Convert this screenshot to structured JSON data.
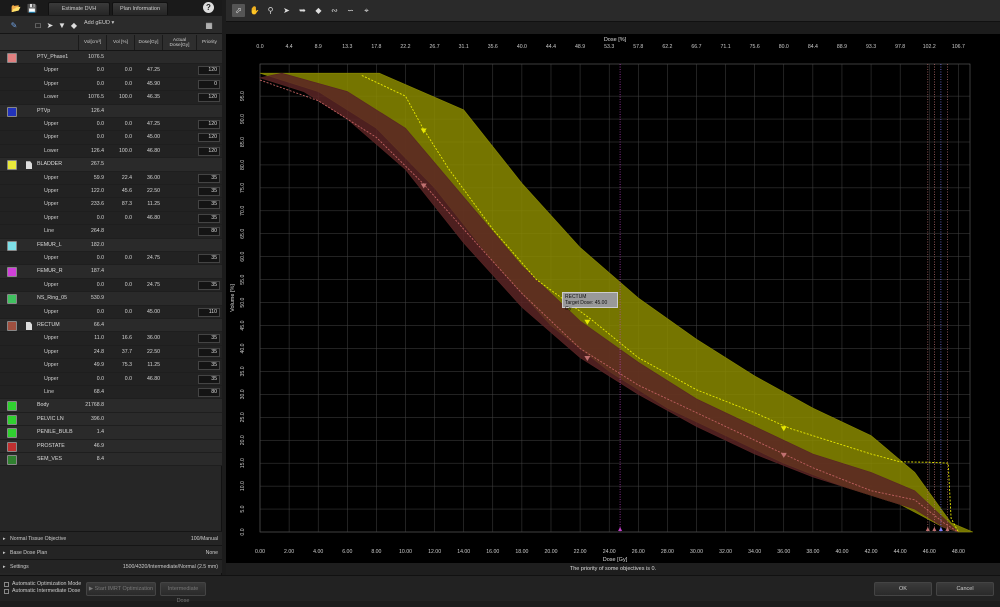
{
  "left_tabs": [
    {
      "label": "Estimate DVH"
    },
    {
      "label": "Plan Information"
    }
  ],
  "toolbar": {
    "add_label": "Add gEUD"
  },
  "columns": [
    {
      "label": "Vol[cm³]"
    },
    {
      "label": "Vol [%]"
    },
    {
      "label": "Dose[Gy]"
    },
    {
      "label": "Actual Dose[Gy]"
    },
    {
      "label": "Priority"
    }
  ],
  "rows": [
    {
      "kind": "s",
      "name": "PTV_Phase1",
      "vol": "1076.5",
      "color": "#e08080"
    },
    {
      "kind": "c",
      "label": "Upper",
      "v1": "0.0",
      "v2": "0.0",
      "dose": "47.25",
      "pri": "120"
    },
    {
      "kind": "c",
      "label": "Upper",
      "v1": "0.0",
      "v2": "0.0",
      "dose": "45.90",
      "pri": "0"
    },
    {
      "kind": "c",
      "label": "Lower",
      "v1": "1076.5",
      "v2": "100.0",
      "dose": "46.35",
      "pri": "120"
    },
    {
      "kind": "s",
      "name": "PTVp",
      "vol": "126.4",
      "color": "#2233bb"
    },
    {
      "kind": "c",
      "label": "Upper",
      "v1": "0.0",
      "v2": "0.0",
      "dose": "47.25",
      "pri": "120"
    },
    {
      "kind": "c",
      "label": "Upper",
      "v1": "0.0",
      "v2": "0.0",
      "dose": "45.00",
      "pri": "120"
    },
    {
      "kind": "c",
      "label": "Lower",
      "v1": "126.4",
      "v2": "100.0",
      "dose": "46.80",
      "pri": "120"
    },
    {
      "kind": "s",
      "name": "BLADDER",
      "vol": "267.5",
      "color": "#e8e83a",
      "doc": true
    },
    {
      "kind": "c",
      "label": "Upper",
      "v1": "59.9",
      "v2": "22.4",
      "dose": "36.00",
      "pri": "35"
    },
    {
      "kind": "c",
      "label": "Upper",
      "v1": "122.0",
      "v2": "45.6",
      "dose": "22.50",
      "pri": "35"
    },
    {
      "kind": "c",
      "label": "Upper",
      "v1": "233.6",
      "v2": "87.3",
      "dose": "11.25",
      "pri": "35"
    },
    {
      "kind": "c",
      "label": "Upper",
      "v1": "0.0",
      "v2": "0.0",
      "dose": "46.80",
      "pri": "35"
    },
    {
      "kind": "c",
      "label": "Line",
      "v1": "264.8",
      "v2": "",
      "dose": "",
      "pri": "80"
    },
    {
      "kind": "s",
      "name": "FEMUR_L",
      "vol": "182.0",
      "color": "#7ee0e8"
    },
    {
      "kind": "c",
      "label": "Upper",
      "v1": "0.0",
      "v2": "0.0",
      "dose": "24.75",
      "pri": "35"
    },
    {
      "kind": "s",
      "name": "FEMUR_R",
      "vol": "187.4",
      "color": "#d040d8"
    },
    {
      "kind": "c",
      "label": "Upper",
      "v1": "0.0",
      "v2": "0.0",
      "dose": "24.75",
      "pri": "35"
    },
    {
      "kind": "s",
      "name": "NS_Ring_05",
      "vol": "530.9",
      "color": "#40c060"
    },
    {
      "kind": "c",
      "label": "Upper",
      "v1": "0.0",
      "v2": "0.0",
      "dose": "45.00",
      "pri": "110"
    },
    {
      "kind": "s",
      "name": "RECTUM",
      "vol": "66.4",
      "color": "#a05040",
      "doc": true
    },
    {
      "kind": "c",
      "label": "Upper",
      "v1": "11.0",
      "v2": "16.6",
      "dose": "36.00",
      "pri": "35"
    },
    {
      "kind": "c",
      "label": "Upper",
      "v1": "24.8",
      "v2": "37.7",
      "dose": "22.50",
      "pri": "35"
    },
    {
      "kind": "c",
      "label": "Upper",
      "v1": "49.9",
      "v2": "75.3",
      "dose": "11.25",
      "pri": "35"
    },
    {
      "kind": "c",
      "label": "Upper",
      "v1": "0.0",
      "v2": "0.0",
      "dose": "46.80",
      "pri": "35"
    },
    {
      "kind": "c",
      "label": "Line",
      "v1": "68.4",
      "v2": "",
      "dose": "",
      "pri": "80"
    },
    {
      "kind": "s",
      "name": "Body",
      "vol": "21768.8",
      "color": "#30d030"
    },
    {
      "kind": "s",
      "name": "PELVIC LN",
      "vol": "396.0",
      "color": "#30d030"
    },
    {
      "kind": "s",
      "name": "PENILE_BULB",
      "vol": "1.4",
      "color": "#30d030"
    },
    {
      "kind": "s",
      "name": "PROSTATE",
      "vol": "46.9",
      "color": "#c03030"
    },
    {
      "kind": "s",
      "name": "SEM_VES",
      "vol": "8.4",
      "color": "#308030"
    }
  ],
  "sections": [
    {
      "label": "Normal Tissue Objective",
      "value": "100/Manual"
    },
    {
      "label": "Base Dose Plan",
      "value": "None"
    },
    {
      "label": "Settings",
      "value": "1500/4320/Intermediate/Normal (2.5 mm)"
    }
  ],
  "footer": {
    "mode1": "Automatic Optimization Mode",
    "mode2": "Automatic Intermediate Dose",
    "start": "Start IMRT Optimization",
    "intermediate": "Intermediate Dose",
    "ok": "OK",
    "cancel": "Cancel"
  },
  "status": "The priority of some objectives is 0.",
  "tooltip": {
    "line1": "RECTUM",
    "line2": "Target Dose: 45.00 Gy"
  },
  "chart_data": {
    "type": "line",
    "title": "",
    "xlabel": "Dose [Gy]",
    "top_xlabel": "Dose [%]",
    "ylabel": "Volume [%]",
    "xlim": [
      0,
      48
    ],
    "ylim": [
      0,
      100
    ],
    "x_ticks": [
      "0.00",
      "2.00",
      "4.00",
      "6.00",
      "8.00",
      "10.00",
      "12.00",
      "14.00",
      "16.00",
      "18.00",
      "20.00",
      "22.00",
      "24.00",
      "26.00",
      "28.00",
      "30.00",
      "32.00",
      "34.00",
      "36.00",
      "38.00",
      "40.00",
      "42.00",
      "44.00",
      "46.00",
      "48.00"
    ],
    "top_ticks": [
      "0.0",
      "4.4",
      "8.9",
      "13.3",
      "17.8",
      "22.2",
      "26.7",
      "31.1",
      "35.6",
      "40.0",
      "44.4",
      "48.9",
      "53.3",
      "57.8",
      "62.2",
      "66.7",
      "71.1",
      "75.6",
      "80.0",
      "84.4",
      "88.9",
      "93.3",
      "97.8",
      "102.2",
      "106.7"
    ],
    "y_ticks": [
      "0.0",
      "5.0",
      "10.0",
      "15.0",
      "20.0",
      "25.0",
      "30.0",
      "35.0",
      "40.0",
      "45.0",
      "50.0",
      "55.0",
      "60.0",
      "65.0",
      "70.0",
      "75.0",
      "80.0",
      "85.0",
      "90.0",
      "95.0"
    ],
    "bladder_band": {
      "color": "#8a8a00",
      "upper": [
        [
          6.2,
          100
        ],
        [
          8.2,
          100
        ],
        [
          14,
          92
        ],
        [
          18,
          76
        ],
        [
          22,
          62
        ],
        [
          26,
          51
        ],
        [
          30,
          42
        ],
        [
          34,
          34
        ],
        [
          38,
          27
        ],
        [
          42,
          21
        ],
        [
          45,
          13
        ],
        [
          47.5,
          2
        ],
        [
          49,
          0
        ]
      ],
      "lower": [
        [
          0,
          100
        ],
        [
          4,
          96
        ],
        [
          8,
          88
        ],
        [
          12,
          75
        ],
        [
          16,
          59
        ],
        [
          20,
          45
        ],
        [
          24,
          35
        ],
        [
          28,
          27
        ],
        [
          32,
          21
        ],
        [
          36,
          15
        ],
        [
          40,
          10
        ],
        [
          44,
          6
        ],
        [
          47,
          1
        ],
        [
          48,
          0
        ]
      ]
    },
    "rectum_band": {
      "color": "#5a2424",
      "upper": [
        [
          1.5,
          100
        ],
        [
          6,
          96
        ],
        [
          10,
          88
        ],
        [
          14,
          73
        ],
        [
          18,
          58
        ],
        [
          22,
          46
        ],
        [
          26,
          37
        ],
        [
          30,
          29
        ],
        [
          34,
          23
        ],
        [
          38,
          17
        ],
        [
          42,
          13
        ],
        [
          45,
          9
        ],
        [
          47,
          3
        ],
        [
          48,
          0
        ]
      ],
      "lower": [
        [
          0,
          99
        ],
        [
          3,
          96
        ],
        [
          6,
          90
        ],
        [
          10,
          79
        ],
        [
          14,
          63
        ],
        [
          18,
          49
        ],
        [
          22,
          38
        ],
        [
          26,
          30
        ],
        [
          30,
          23
        ],
        [
          34,
          17
        ],
        [
          38,
          12
        ],
        [
          42,
          8
        ],
        [
          45,
          5
        ],
        [
          47,
          1
        ],
        [
          48,
          0
        ]
      ]
    },
    "bladder_line": {
      "color": "#e8e800",
      "points": [
        [
          7,
          99.5
        ],
        [
          10,
          95
        ],
        [
          11.2,
          88
        ],
        [
          13,
          79
        ],
        [
          16,
          66
        ],
        [
          19,
          55
        ],
        [
          22.7,
          46.5
        ],
        [
          26,
          38
        ],
        [
          30,
          31
        ],
        [
          34,
          26
        ],
        [
          36.4,
          22.6
        ],
        [
          40,
          19
        ],
        [
          42,
          17
        ],
        [
          44,
          15.3
        ],
        [
          46,
          15.2
        ],
        [
          47.3,
          15
        ],
        [
          47.5,
          3
        ],
        [
          48,
          0
        ]
      ]
    },
    "rectum_line": {
      "color": "#c06060",
      "points": [
        [
          0,
          98.5
        ],
        [
          4,
          94
        ],
        [
          8,
          86
        ],
        [
          11.2,
          76
        ],
        [
          14,
          66
        ],
        [
          18,
          52
        ],
        [
          22,
          40
        ],
        [
          26,
          32
        ],
        [
          30,
          26
        ],
        [
          34,
          20
        ],
        [
          38,
          14
        ],
        [
          42,
          9
        ],
        [
          45,
          7
        ],
        [
          47,
          2
        ],
        [
          48,
          0
        ]
      ]
    },
    "objectives": [
      {
        "x": 11.25,
        "y": 87.3,
        "color": "#e8e800"
      },
      {
        "x": 22.5,
        "y": 45.6,
        "color": "#e8e800"
      },
      {
        "x": 36,
        "y": 22.4,
        "color": "#e8e800"
      },
      {
        "x": 11.25,
        "y": 75.3,
        "color": "#c07070"
      },
      {
        "x": 22.5,
        "y": 37.7,
        "color": "#c07070"
      },
      {
        "x": 36,
        "y": 16.6,
        "color": "#c07070"
      }
    ],
    "vlines": [
      {
        "x": 24.75,
        "color": "#c040c8"
      },
      {
        "x": 45.9,
        "color": "#c07070"
      },
      {
        "x": 46.35,
        "color": "#c07070"
      },
      {
        "x": 46.8,
        "color": "#8080ff"
      },
      {
        "x": 47.25,
        "color": "#c07070"
      }
    ]
  }
}
